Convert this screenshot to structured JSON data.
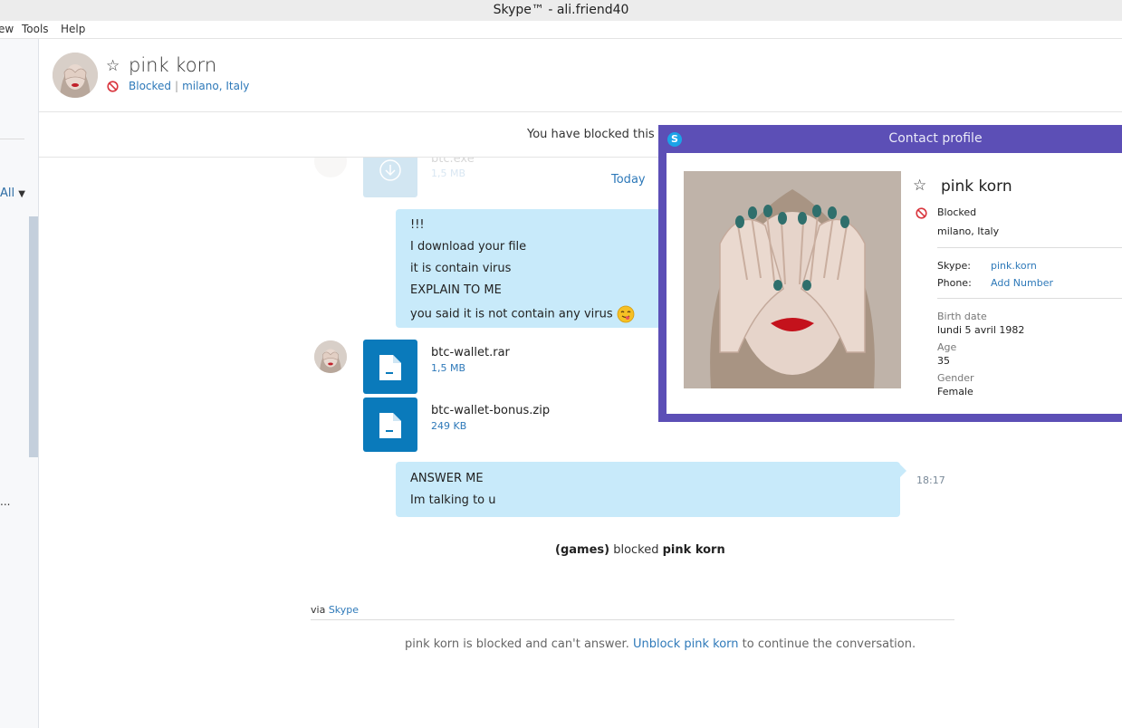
{
  "window": {
    "title": "Skype™ - ali.friend40"
  },
  "menu": {
    "items": [
      "ew",
      "Tools",
      "Help"
    ]
  },
  "sidebar": {
    "filter_label": "All",
    "truncated_text": "..."
  },
  "header": {
    "contact_name": "pink korn",
    "status": "Blocked",
    "location": "milano, Italy"
  },
  "banner": {
    "text": "You have blocked this co"
  },
  "chat": {
    "faded_file": {
      "name": "btc.exe",
      "size": "1,5 MB"
    },
    "date_divider": "Today",
    "outgoing_1": {
      "lines": [
        "!!!",
        "I download your file",
        "it is contain virus",
        "EXPLAIN TO ME",
        "you said it is not contain any virus"
      ],
      "emoji": "😋"
    },
    "files": [
      {
        "name": "btc-wallet.rar",
        "size": "1,5 MB"
      },
      {
        "name": "btc-wallet-bonus.zip",
        "size": "249 KB"
      }
    ],
    "outgoing_2": {
      "lines": [
        "ANSWER ME",
        "Im talking to u"
      ],
      "time": "18:17"
    },
    "system": {
      "actor": "(games)",
      "action": "blocked",
      "target": "pink korn"
    },
    "via": {
      "prefix": "via",
      "service": "Skype"
    },
    "footer": {
      "text_before": "pink korn is blocked and can't answer.",
      "link": "Unblock pink korn",
      "text_after": "to continue the conversation."
    }
  },
  "profile": {
    "title": "Contact profile",
    "logo_letter": "S",
    "name": "pink korn",
    "status": "Blocked",
    "location": "milano, Italy",
    "skype_label": "Skype:",
    "skype_value": "pink.korn",
    "phone_label": "Phone:",
    "phone_value": "Add Number",
    "birth_label": "Birth date",
    "birth_value": "lundi 5 avril 1982",
    "age_label": "Age",
    "age_value": "35",
    "gender_label": "Gender",
    "gender_value": "Female"
  },
  "colors": {
    "accent": "#2e79b9",
    "bubble": "#c8eafa",
    "file_tile": "#0a7abb",
    "profile_frame": "#5c4fb6",
    "blocked_red": "#d9363e"
  }
}
